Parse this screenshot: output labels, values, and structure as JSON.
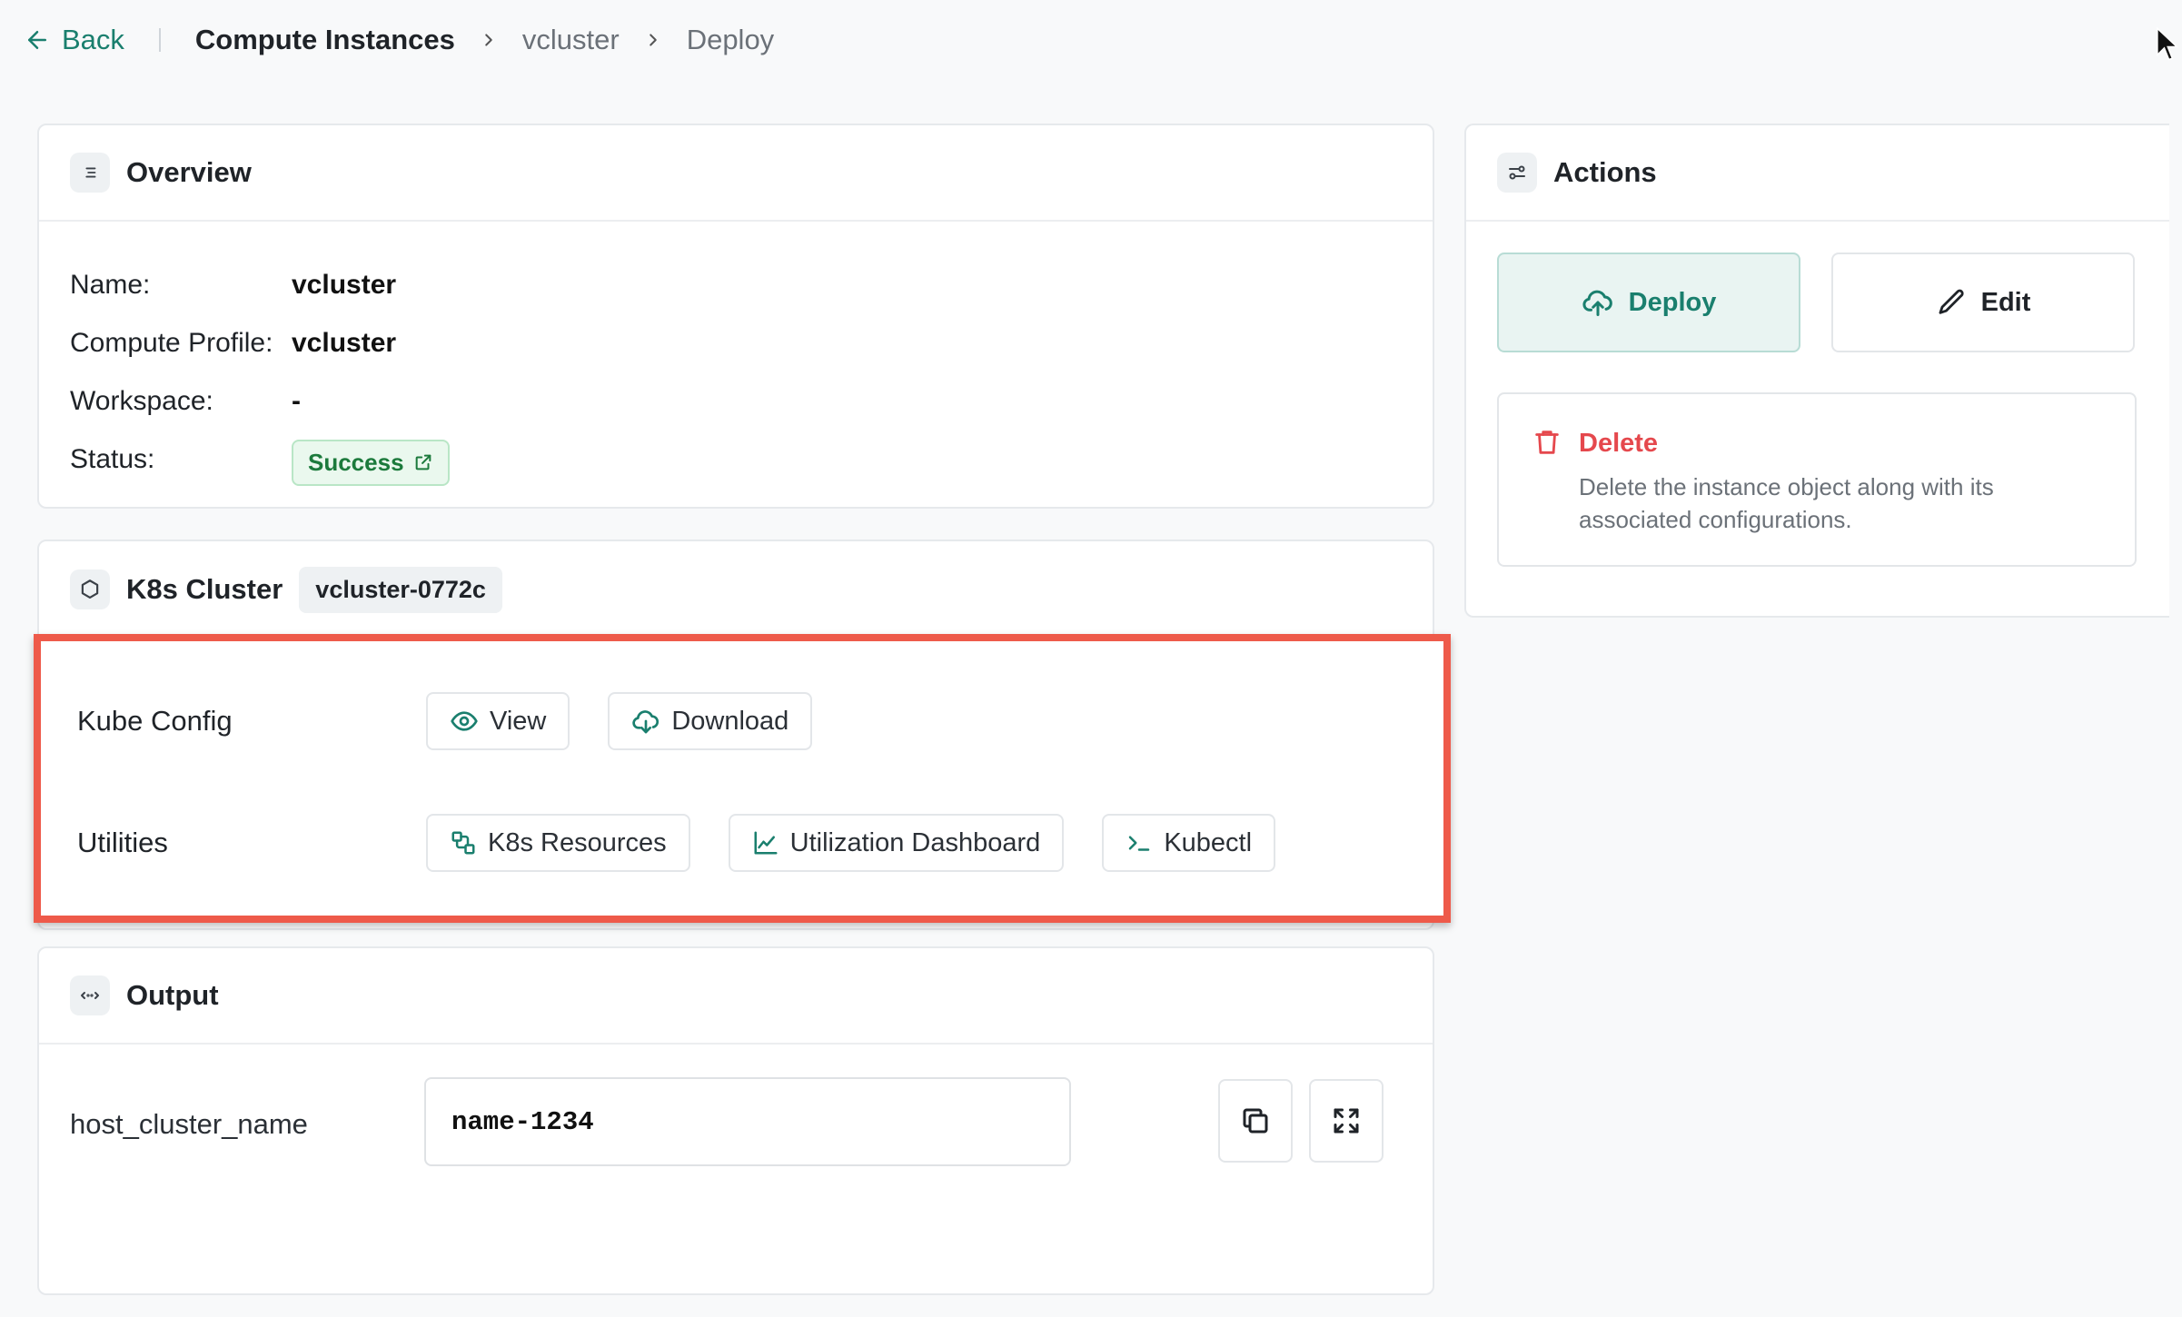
{
  "breadcrumb": {
    "back_label": "Back",
    "current": "Compute Instances",
    "items": [
      "vcluster",
      "Deploy"
    ]
  },
  "overview": {
    "title": "Overview",
    "rows": [
      {
        "label": "Name:",
        "value": "vcluster"
      },
      {
        "label": "Compute Profile:",
        "value": "vcluster"
      },
      {
        "label": "Workspace:",
        "value": "-"
      }
    ],
    "status_label": "Status:",
    "status_value": "Success"
  },
  "k8s": {
    "title": "K8s Cluster",
    "cluster_id": "vcluster-0772c",
    "kube_config_label": "Kube Config",
    "view_label": "View",
    "download_label": "Download",
    "utilities_label": "Utilities",
    "utilities": [
      "K8s Resources",
      "Utilization Dashboard",
      "Kubectl"
    ]
  },
  "output": {
    "title": "Output",
    "field_label": "host_cluster_name",
    "field_value": "name-1234"
  },
  "actions": {
    "title": "Actions",
    "deploy_label": "Deploy",
    "edit_label": "Edit",
    "delete_title": "Delete",
    "delete_desc": "Delete the instance object along with its associated configurations."
  },
  "colors": {
    "accent": "#1a7f6e",
    "danger": "#e5484d",
    "success": "#1c7a3c",
    "highlight": "#ee5a4a"
  }
}
